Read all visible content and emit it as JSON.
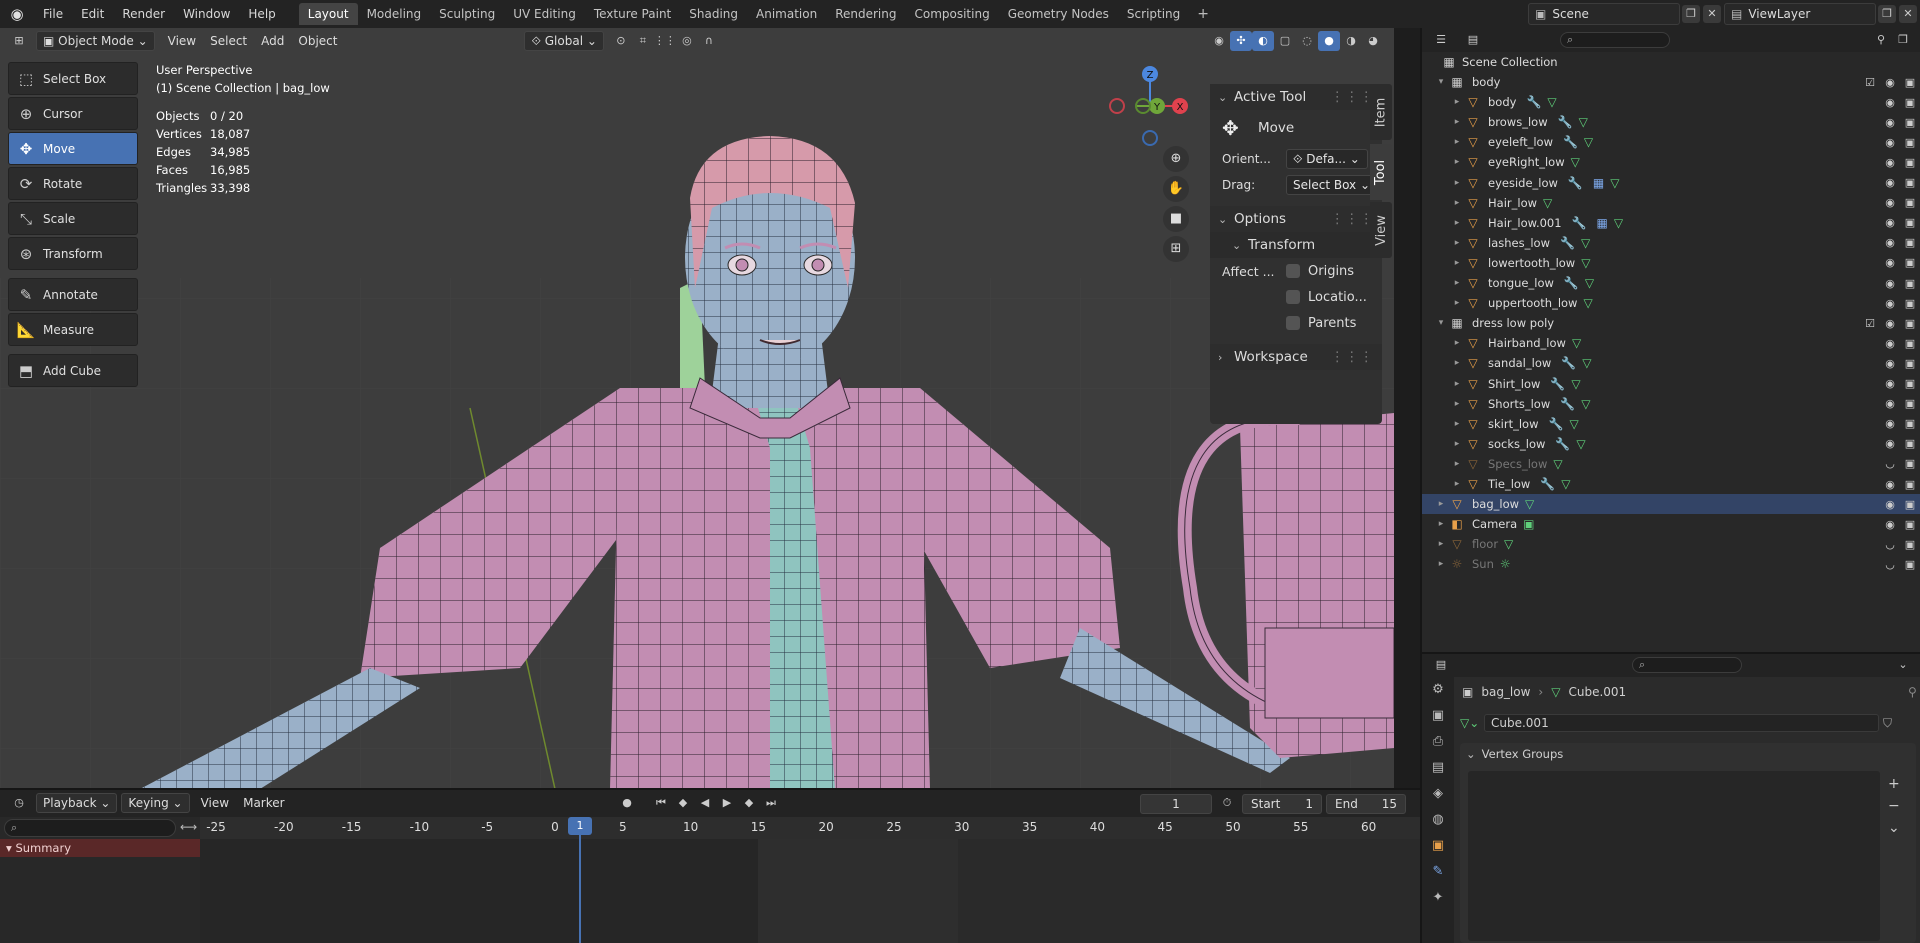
{
  "topbar": {
    "menus": [
      "File",
      "Edit",
      "Render",
      "Window",
      "Help"
    ],
    "workspaces": [
      "Layout",
      "Modeling",
      "Sculpting",
      "UV Editing",
      "Texture Paint",
      "Shading",
      "Animation",
      "Rendering",
      "Compositing",
      "Geometry Nodes",
      "Scripting"
    ],
    "active_workspace": "Layout",
    "scene": "Scene",
    "view_layer": "ViewLayer"
  },
  "viewport_header": {
    "mode": "Object Mode",
    "menus": [
      "View",
      "Select",
      "Add",
      "Object"
    ],
    "orientation": "Global"
  },
  "toolbar": {
    "tools": [
      {
        "label": "Select Box",
        "icon": "select-box-icon"
      },
      {
        "label": "Cursor",
        "icon": "cursor-icon"
      },
      {
        "label": "Move",
        "icon": "move-icon",
        "active": true
      },
      {
        "label": "Rotate",
        "icon": "rotate-icon"
      },
      {
        "label": "Scale",
        "icon": "scale-icon"
      },
      {
        "label": "Transform",
        "icon": "transform-icon"
      },
      {
        "label": "Annotate",
        "icon": "annotate-icon"
      },
      {
        "label": "Measure",
        "icon": "measure-icon"
      },
      {
        "label": "Add Cube",
        "icon": "add-cube-icon"
      }
    ]
  },
  "viewport_info": {
    "perspective": "User Perspective",
    "context": "(1) Scene Collection | bag_low",
    "stats": [
      {
        "label": "Objects",
        "value": "0 / 20"
      },
      {
        "label": "Vertices",
        "value": "18,087"
      },
      {
        "label": "Edges",
        "value": "34,985"
      },
      {
        "label": "Faces",
        "value": "16,985"
      },
      {
        "label": "Triangles",
        "value": "33,398"
      }
    ]
  },
  "gizmo": {
    "x": "X",
    "y": "Y",
    "z": "Z"
  },
  "npanel": {
    "tabs": [
      "Item",
      "Tool",
      "View"
    ],
    "active_tab": "Tool",
    "active_tool_title": "Active Tool",
    "active_tool_name": "Move",
    "orient_label": "Orient...",
    "orient_value": "Defa...",
    "drag_label": "Drag:",
    "drag_value": "Select Box",
    "options_title": "Options",
    "transform_title": "Transform",
    "affect_label": "Affect ...",
    "affect_options": [
      "Origins",
      "Locatio...",
      "Parents"
    ],
    "workspace_title": "Workspace"
  },
  "timeline": {
    "menus": [
      "Playback",
      "Keying",
      "View",
      "Marker"
    ],
    "current_frame": "1",
    "start_label": "Start",
    "start": "1",
    "end_label": "End",
    "end": "15",
    "summary": "Summary",
    "ruler": [
      "-25",
      "-20",
      "-15",
      "-10",
      "-5",
      "0",
      "5",
      "10",
      "15",
      "20",
      "25",
      "30",
      "35",
      "40",
      "45",
      "50",
      "55",
      "60"
    ]
  },
  "outliner": {
    "root": "Scene Collection",
    "rows": [
      {
        "name": "body",
        "type": "collection",
        "level": 1,
        "expanded": true
      },
      {
        "name": "body",
        "type": "mesh",
        "level": 2,
        "mod": true
      },
      {
        "name": "brows_low",
        "type": "mesh",
        "level": 2,
        "mod": true
      },
      {
        "name": "eyeleft_low",
        "type": "mesh",
        "level": 2,
        "mod": true
      },
      {
        "name": "eyeRight_low",
        "type": "mesh",
        "level": 2
      },
      {
        "name": "eyeside_low",
        "type": "mesh",
        "level": 2,
        "mod": true,
        "mat": true
      },
      {
        "name": "Hair_low",
        "type": "mesh",
        "level": 2
      },
      {
        "name": "Hair_low.001",
        "type": "mesh",
        "level": 2,
        "mod": true,
        "mat": true
      },
      {
        "name": "lashes_low",
        "type": "mesh",
        "level": 2,
        "mod": true
      },
      {
        "name": "lowertooth_low",
        "type": "mesh",
        "level": 2
      },
      {
        "name": "tongue_low",
        "type": "mesh",
        "level": 2,
        "mod": true
      },
      {
        "name": "uppertooth_low",
        "type": "mesh",
        "level": 2
      },
      {
        "name": "dress low poly",
        "type": "collection",
        "level": 1,
        "expanded": true
      },
      {
        "name": "Hairband_low",
        "type": "mesh",
        "level": 2
      },
      {
        "name": "sandal_low",
        "type": "mesh",
        "level": 2,
        "mod": true
      },
      {
        "name": "Shirt_low",
        "type": "mesh",
        "level": 2,
        "mod": true
      },
      {
        "name": "Shorts_low",
        "type": "mesh",
        "level": 2,
        "mod": true
      },
      {
        "name": "skirt_low",
        "type": "mesh",
        "level": 2,
        "mod": true
      },
      {
        "name": "socks_low",
        "type": "mesh",
        "level": 2,
        "mod": true
      },
      {
        "name": "Specs_low",
        "type": "mesh",
        "level": 2,
        "dim": true
      },
      {
        "name": "Tie_low",
        "type": "mesh",
        "level": 2,
        "mod": true
      },
      {
        "name": "bag_low",
        "type": "mesh",
        "level": 1,
        "selected": true
      },
      {
        "name": "Camera",
        "type": "camera",
        "level": 1
      },
      {
        "name": "floor",
        "type": "mesh",
        "level": 1,
        "dim": true
      },
      {
        "name": "Sun",
        "type": "light",
        "level": 1,
        "dim": true
      }
    ]
  },
  "properties": {
    "breadcrumb_object": "bag_low",
    "breadcrumb_data": "Cube.001",
    "data_name": "Cube.001",
    "panel": "Vertex Groups"
  },
  "colors": {
    "accent": "#4772b3",
    "pink": "#c28db2",
    "blue": "#9ab0c8",
    "green": "#9ed29a"
  }
}
